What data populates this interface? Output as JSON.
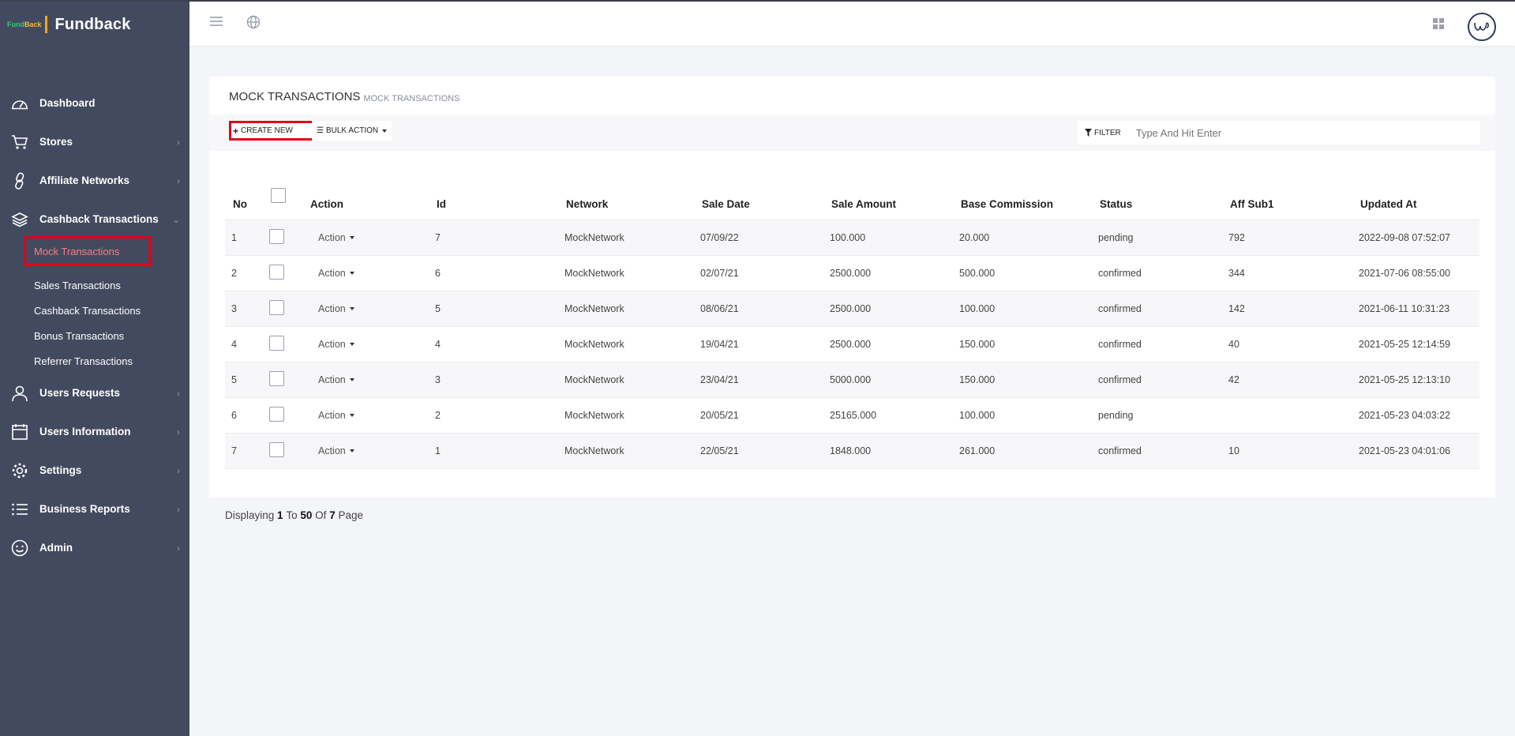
{
  "brand": {
    "logo_text_1": "Fund",
    "logo_text_2": "Back",
    "name": "Fundback"
  },
  "sidebar": {
    "items": [
      {
        "label": "Dashboard",
        "icon": "dashboard-icon"
      },
      {
        "label": "Stores",
        "icon": "cart-icon"
      },
      {
        "label": "Affiliate Networks",
        "icon": "link-icon"
      },
      {
        "label": "Cashback Transactions",
        "icon": "layers-icon"
      },
      {
        "label": "Users Requests",
        "icon": "user-icon"
      },
      {
        "label": "Users Information",
        "icon": "calendar-icon"
      },
      {
        "label": "Settings",
        "icon": "gear-icon"
      },
      {
        "label": "Business Reports",
        "icon": "list-icon"
      },
      {
        "label": "Admin",
        "icon": "smile-icon"
      }
    ],
    "sub_items": [
      "Mock Transactions",
      "Sales Transactions",
      "Cashback Transactions",
      "Bonus Transactions",
      "Referrer Transactions"
    ]
  },
  "panel": {
    "title": "MOCK TRANSACTIONS",
    "subtitle": "MOCK TRANSACTIONS",
    "create_label": "CREATE NEW",
    "bulk_label": "BULK ACTION",
    "filter_label": "FILTER",
    "filter_placeholder": "Type And Hit Enter"
  },
  "table": {
    "headers": [
      "No",
      "",
      "Action",
      "Id",
      "Network",
      "Sale Date",
      "Sale Amount",
      "Base Commission",
      "Status",
      "Aff Sub1",
      "Updated At"
    ],
    "action_label": "Action",
    "rows": [
      [
        "1",
        "7",
        "MockNetwork",
        "07/09/22",
        "100.000",
        "20.000",
        "pending",
        "792",
        "2022-09-08 07:52:07"
      ],
      [
        "2",
        "6",
        "MockNetwork",
        "02/07/21",
        "2500.000",
        "500.000",
        "confirmed",
        "344",
        "2021-07-06 08:55:00"
      ],
      [
        "3",
        "5",
        "MockNetwork",
        "08/06/21",
        "2500.000",
        "100.000",
        "confirmed",
        "142",
        "2021-06-11 10:31:23"
      ],
      [
        "4",
        "4",
        "MockNetwork",
        "19/04/21",
        "2500.000",
        "150.000",
        "confirmed",
        "40",
        "2021-05-25 12:14:59"
      ],
      [
        "5",
        "3",
        "MockNetwork",
        "23/04/21",
        "5000.000",
        "150.000",
        "confirmed",
        "42",
        "2021-05-25 12:13:10"
      ],
      [
        "6",
        "2",
        "MockNetwork",
        "20/05/21",
        "25165.000",
        "100.000",
        "pending",
        "",
        "2021-05-23 04:03:22"
      ],
      [
        "7",
        "1",
        "MockNetwork",
        "22/05/21",
        "1848.000",
        "261.000",
        "confirmed",
        "10",
        "2021-05-23 04:01:06"
      ]
    ]
  },
  "footer": {
    "prefix": "Displaying",
    "from": "1",
    "to_word": "To",
    "to": "50",
    "of_word": "Of",
    "total": "7",
    "suffix": "Page"
  }
}
